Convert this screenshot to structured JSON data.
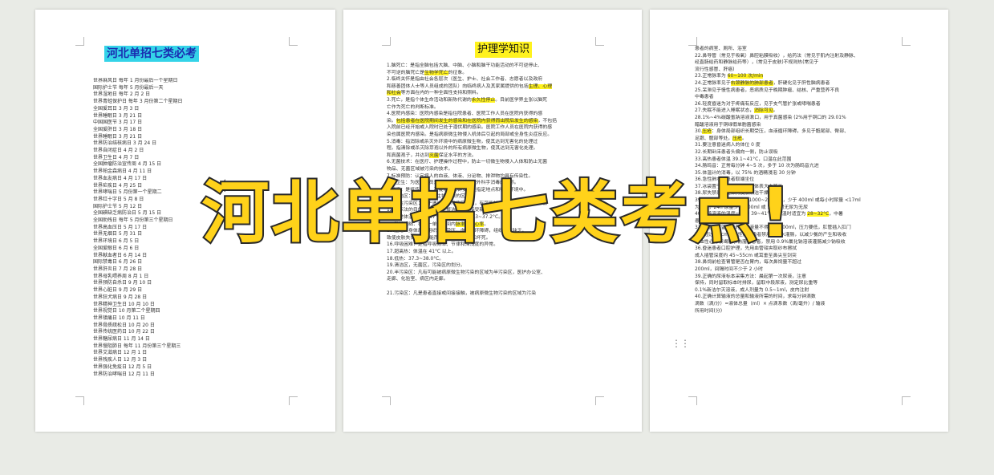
{
  "page1": {
    "title": "河北单招七类必考",
    "lines": [
      "世界麻风日 每年 1 月份最后一个星期日",
      "国际护士节 每年 5 月份最后一天",
      "世界湿地日 每年 2 月 2 日",
      "世界青蛙保护日 每年 3 月份第二个星期日",
      "全国爱耳日 3 月 3 日",
      "世界睡眠日 3 月 21 日",
      "中国国医节 3 月 17 日",
      "全国爱肝日 3 月 18 日",
      "世界睡眠日 3 月 21 日",
      "世界防治结核病日 3 月 24 日",
      "世界自闭症日 4 月 2 日",
      "世界卫生日 4 月 7 日",
      "全国肿瘤防治宣传周 4 月 15 日",
      "世界帕金森病日 4 月 11 日",
      "世界血友病日 4 月 17 日",
      "世界疟疾日 4 月 25 日",
      "世界哮喘日 5 月份第一个星期二",
      "世界红十字日 5 月 8 日",
      "国际护士节 5 月 12 日",
      "全国碘缺乏病防治日 5 月 15 日",
      "全国助残日 每年 5 月份第三个星期日",
      "世界高血压日 5 月 17 日",
      "世界无烟日 5 月 31 日",
      "世界环境日 6 月 5 日",
      "全国爱眼日 6 月 6 日",
      "世界献血者日 6 月 14 日",
      "国际禁毒日 6 月 26 日",
      "世界肝炎日 7 月 28 日",
      "世界母乳喂养周 8 月 1 日",
      "世界预防自杀日 9 月 10 日",
      "世界心脏日 9 月 29 日",
      "世界狂犬病日 9 月 28 日",
      "世界精神卫生日 10 月 10 日",
      "世界视觉日 10 月第二个星期四",
      "世界镇痛日 10 月 11 日",
      "世界骨质疏松日 10 月 20 日",
      "世界传统医药日 10 月 22 日",
      "世界糖尿病日 11 月 14 日",
      "世界慢阻肺日 每年 11 月份第三个星期三",
      "世界艾滋病日 12 月 1 日",
      "世界残疾人日 12 月 3 日",
      "世界强化免疫日 12 月 5 日",
      "世界防治哮喘日 12 月 11 日"
    ]
  },
  "page2": {
    "title": "护理学知识",
    "lines": [
      "1.脑死亡：是指全脑包括大脑、中脑、小脑和脑干功能活动的不可逆停止,",
      "不可逆的脑死亡是生物学死亡的征象。",
      "2.临终关怀是指由社会各层次（医生、护士、社会工作者、志愿者以及政府",
      "和慈善团体人士等人员组成的团队）向临终病人及其家属提供的包括生理、心理",
      "和社会等方面在内的一种全面性支持和照料。",
      "3.死亡，是指个体生命活动和新陈代谢的永久性停止。目前医学界主张以脑死",
      "亡作为死亡的判断标准。",
      "4.医院内感染：医院内感染是指住院患者、医院工作人员在医院内获得的感",
      "染。包括患者在医院期间发生的感染和在医院内获得而出院后发生的感染，不包括",
      "入院前已经开始或入院时已处于潜伏期的感染。医院工作人员在医院内获得的感",
      "染也属医院内感染。是指病原微生物侵入机体后引起的局部或全身性炎症反应。",
      "5.消毒：指消除或杀灭外环境中的病原微生物，使其达到无害化的处理过",
      "程。指清除或杀灭除芽孢以外的所有病原微生物，使其达到无害化处理。",
      "和真菌孢子，并达到灭菌保证水平的方法。",
      "6.无菌技术：在医疗、护理操作过程中，防止一切微生物侵入人体和防止无菌",
      "物品、无菌区域被污染的技术。",
      "7.标准预防：认定病人的血液、体液、分泌物、排泄物均具有传染性。",
      "8.手卫生：为医务人员洗手、卫生手消毒和外科手消毒的总称。",
      "9.隔离：是将传染源、高度易感人群安置在指定地点和特殊环境中。",
      "10.清洁区：未被病原微生物污染的区域。",
      "11.潜在污染区：位于清洁区与污染区之间，有可能被病原微生物污染的区域。",
      "12.铺床法的目的：保持病室整洁，准备接受新病人。",
      "13.正常体温为 36~37°C 之间，口温 36.3~37.2°C。",
      "14.脉搏短绌：在同一单位时间内脉率少于心率。",
      "15.压疮：身体局部组织长期受压，血液循环障碍，组织营养缺乏，",
      "致使皮肤失去正常功能而引起的组织破损和坏死。",
      "16.呼吸困难：是指呼吸频率、节律和深浅度的异常。",
      "17.超高热：体温在 41°C 以上。",
      "18.低热：37.3~38.0°C。",
      "19.清洁区，无菌区，污染区的划分。",
      "20.半污染区：凡有可能被病原微生物污染的区域为半污染区，医护办公室、",
      "走廊、化验室、病区内走廊。",
      "",
      "21.污染区：凡是患者直接或间接接触，被病原微生物污染的区域为污染"
    ],
    "highlights": [
      "生物学死亡",
      "生理、心理",
      "和社会",
      "永久性停止",
      "包括患者在医院期间发生的感染和在医院内获得而出院后发生的感染",
      "灭菌",
      "脉率少于心率"
    ]
  },
  "page3": {
    "lines": [
      "患者的病室、厕所、浴室",
      "22.鼻导管（常见于吸氧）鼻腔粘膜吸收），给药法（常见于肌内注射及静脉、",
      "经直肠给药和静脉给药等），(常见于皮肤)不规则热(常见于",
      "流行性感冒、肝癌)",
      "23.正常脉率为 60~100 次/min",
      "24.正常脉率见于右颈静脉的肺部患者，肝硬化见于肝性脑病患者",
      "25.呆滞见于慢性病患者，恶病质见于晚期肿瘤、结核、严重营养不良",
      "中毒患者",
      "26.轻度昏迷为对于疼痛有反应，见于支气管扩张或哮喘患者",
      "27.失眠不能进入睡眠状态，消除可见。",
      "28.1%~4%碳酸氢钠溶液漱口，用于真菌感染 (2%用于铜口的 29.01%",
      "醋酸溶液用于铜绿假单胞菌感染",
      "30.压疮：身体局部组织长期受压，血液循环障碍，多见于骶尾部、臀部、",
      "足跟、髋部等处，压疮。",
      "31.要注意昏迷病人的体位 0 度",
      "32.长期卧床患者头偏向一侧，防止误吸",
      "33.高热患者体温 39.1~41°C，口温在此范围",
      "34.肠鸣音：正常每分钟 4~5 次，多于 10 次为肠鸣音亢进",
      "35.体温计的消毒，以 75% 的酒精浸泡 30 分钟",
      "36.急性肺水肿患者取端坐位",
      "37.冰袋置于前额、头顶部和体表大血管处",
      "38.尿失禁患者应保持皮肤清洁干燥",
      "39.正常成人 24h 尿量约 1000~2000ml，少于 400ml 或每小时尿量 <17ml",
      "为少尿，24h 尿量少于 100ml 或 12 小时无尿为无尿",
      "40.灌肠溶液的温度一般为 39~41°C，降温时适宜为 28~32°C，中暑",
      "患者可用 4°C 生理盐水",
      "33.大量不保留灌肠时，溶液量不得超过 500ml，压力要低，肛管插入肛门",
      "不得超过 30cm，肝性脑病患者禁用肥皂水灌肠，以减少氨的产生和吸收",
      "充血性心力衰竭和水钠潴留患者，禁用 0.9%氯化钠溶液灌肠减少钠吸收",
      "36.昏迷患者口腔护理，先用血管钳夹取纱布擦拭",
      "成人插管深度约 45~55cm 或耳垂至鼻尖至剑突",
      "38.鼻饲前检查胃管是否在胃内，每次鼻饲量不超过",
      "200ml，间隔时间不少于 2 小时",
      "39.正确的尿液标本采集方法：晨起第一次尿液，注意",
      "保持，同时留取标本时排尿，留取中段尿液，测定尿比重等",
      "0.1%新洁尔灭溶液，成人剂量为 0.5~1ml，皮内注射",
      "40.正确计算输液的总量和输液所需的时间，求每分钟滴数",
      "滴数（滴/分）=液体总量（ml）× 点滴系数（滴/毫升）/ 输液",
      "所用时间(分)"
    ],
    "highlights": [
      "60~100 次/min",
      "右颈静脉的肺部患者",
      "消除可见",
      "压疮",
      "28~32°C"
    ]
  },
  "overlay": {
    "text": "河北单招七类考点!"
  },
  "colors": {
    "overlay_fill": "#ffd21a",
    "overlay_stroke": "#2a2a2a",
    "highlight_yellow": "#fff21e",
    "title_cyan": "#34d3e8"
  }
}
